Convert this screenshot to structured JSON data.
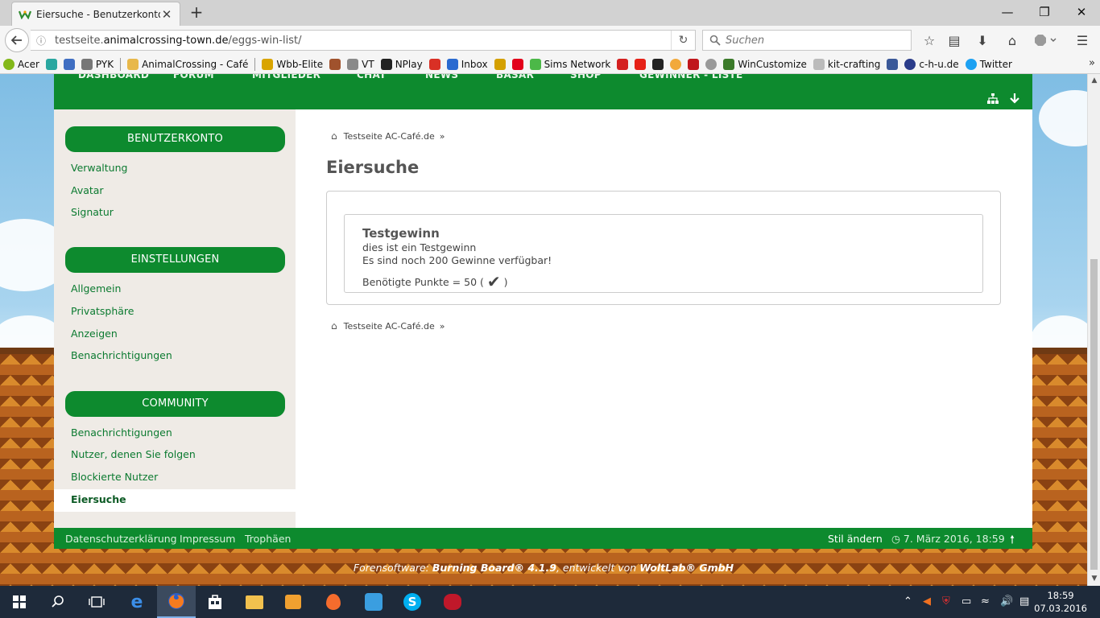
{
  "browser": {
    "tab_title": "Eiersuche - Benutzerkonto...",
    "tab_close": "✕",
    "new_tab": "+",
    "url_prefix": "testseite.",
    "url_domain": "animalcrossing-town.de",
    "url_path": "/eggs-win-list/",
    "search_placeholder": "Suchen",
    "bookmarks": [
      "Acer",
      "PYK",
      "AnimalCrossing - Café",
      "Wbb-Elite",
      "VT",
      "NPlay",
      "Inbox",
      "Sims Network",
      "WinCustomize",
      "kit-crafting",
      "c-h-u.de",
      "Twitter"
    ]
  },
  "site": {
    "menu": [
      "DASHBOARD",
      "FORUM",
      "MITGLIEDER",
      "CHAT",
      "NEWS",
      "BASAR",
      "SHOP",
      "GEWINNER - LISTE"
    ],
    "sidebar": {
      "section1": {
        "title": "BENUTZERKONTO",
        "items": [
          "Verwaltung",
          "Avatar",
          "Signatur"
        ]
      },
      "section2": {
        "title": "EINSTELLUNGEN",
        "items": [
          "Allgemein",
          "Privatsphäre",
          "Anzeigen",
          "Benachrichtigungen"
        ]
      },
      "section3": {
        "title": "COMMUNITY",
        "items": [
          "Benachrichtigungen",
          "Nutzer, denen Sie folgen",
          "Blockierte Nutzer",
          "Eiersuche"
        ]
      }
    },
    "breadcrumb": {
      "label": "Testseite AC-Café.de",
      "sep": "»"
    },
    "page_title": "Eiersuche",
    "prize": {
      "title": "Testgewinn",
      "description": "dies ist ein Testgewinn",
      "remaining": "Es sind noch 200 Gewinne verfügbar!",
      "points_prefix": "Benötigte Punkte = 50 (",
      "points_suffix": ")"
    },
    "footer": {
      "links": [
        "Datenschutzerklärung",
        "Impressum",
        "Trophäen"
      ],
      "style_change": "Stil ändern",
      "datetime": "7. März 2016, 18:59"
    },
    "copyright": {
      "prefix": "Forensoftware: ",
      "product": "Burning Board® 4.1.9",
      "middle": ", entwickelt von ",
      "company": "WoltLab® GmbH"
    }
  },
  "taskbar": {
    "time": "18:59",
    "date": "07.03.2016"
  }
}
